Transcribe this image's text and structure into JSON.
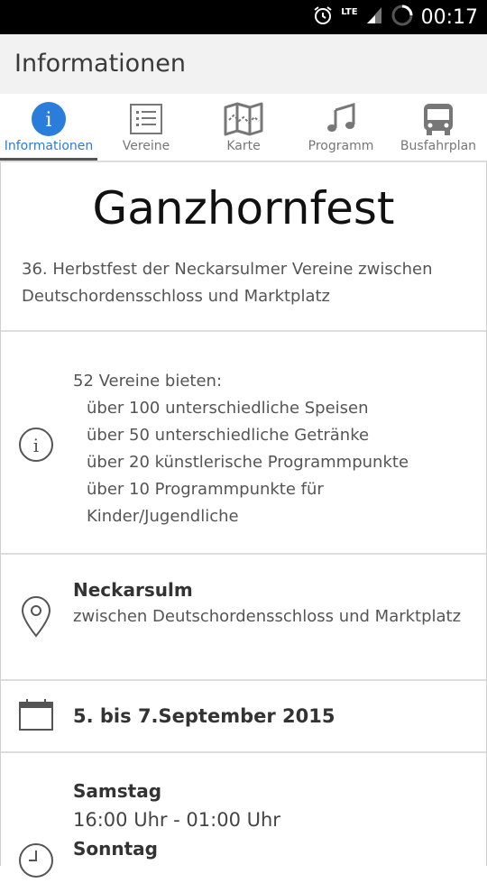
{
  "status_bar": {
    "network": "LTE",
    "time": "00:17"
  },
  "appbar": {
    "title": "Informationen"
  },
  "tabs": [
    {
      "label": "Informationen",
      "icon": "info-icon",
      "active": true
    },
    {
      "label": "Vereine",
      "icon": "list-icon"
    },
    {
      "label": "Karte",
      "icon": "map-icon"
    },
    {
      "label": "Programm",
      "icon": "music-icon"
    },
    {
      "label": "Busfahrplan",
      "icon": "bus-icon"
    }
  ],
  "colors": {
    "accent": "#2b7ddb"
  },
  "event": {
    "title": "Ganzhornfest",
    "subtitle": "36. Herbstfest der Neckarsulmer Vereine zwischen Deutschordensschloss und Marktplatz"
  },
  "offers": {
    "intro": "52 Vereine bieten:",
    "items": [
      "über 100 unterschiedliche Speisen",
      "über 50 unterschiedliche Getränke",
      "über 20 künstlerische Programmpunkte",
      "über 10 Programmpunkte für Kinder/Jugendliche"
    ]
  },
  "location": {
    "name": "Neckarsulm",
    "detail": "zwischen Deutschordensschloss und Marktplatz"
  },
  "date": {
    "text": "5. bis 7.September 2015"
  },
  "hours": {
    "day1": "Samstag",
    "day1_time": "16:00 Uhr - 01:00 Uhr",
    "day2": "Sonntag"
  }
}
